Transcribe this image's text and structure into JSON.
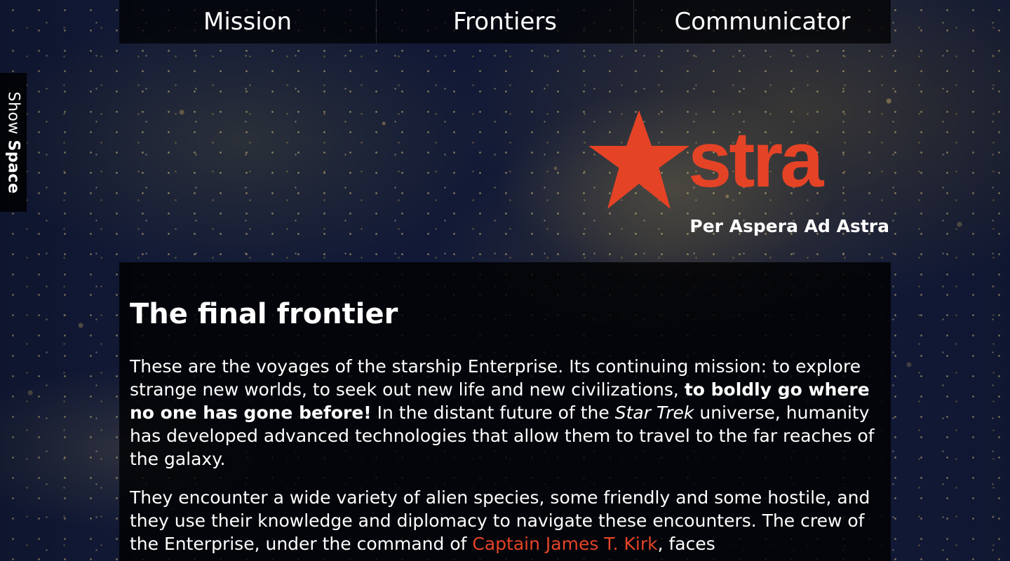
{
  "nav": {
    "items": [
      "Mission",
      "Frontiers",
      "Communicator"
    ]
  },
  "side_toggle": {
    "prefix": "Show",
    "label": "Space"
  },
  "logo": {
    "word": "stra",
    "tagline": "Per Aspera Ad Astra",
    "icon": "red-star-icon",
    "accent_color": "#e54326"
  },
  "article": {
    "title": "The final frontier",
    "p1_start": "These are the voyages of the starship Enterprise. Its continuing mission: to explore strange new worlds, to seek out new life and new civilizations,",
    "p1_bold": "to boldly go where no one has gone before!",
    "p1_middle": "In the distant future of the",
    "p1_italic": "Star Trek",
    "p1_end": "universe, humanity has developed advanced technologies that allow them to travel to the far reaches of the galaxy.",
    "p2_start": "They encounter a wide variety of alien species, some friendly and some hostile, and they use their knowledge and diplomacy to navigate these encounters. The crew of the Enterprise, under the command of",
    "p2_link": "Captain James T. Kirk",
    "p2_end": ", faces"
  }
}
